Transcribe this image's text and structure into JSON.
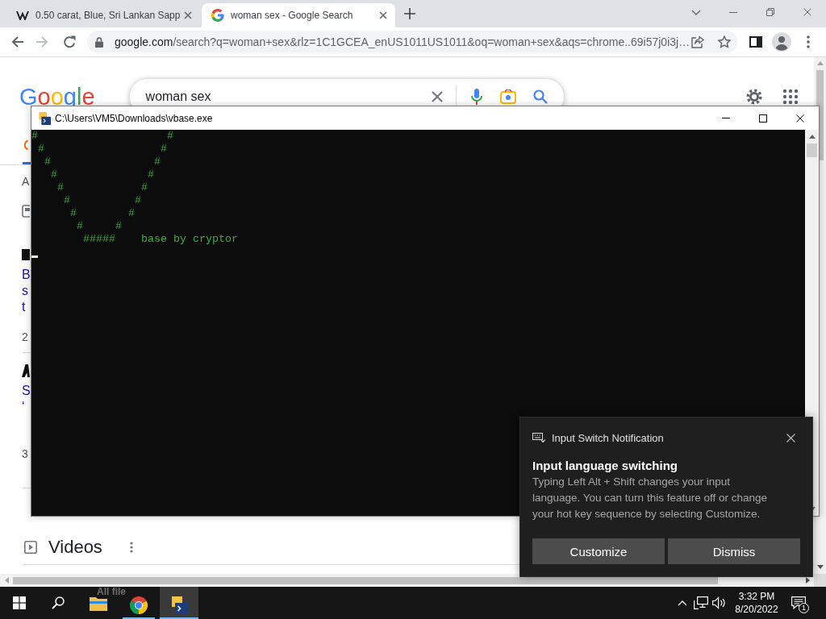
{
  "browser": {
    "tabs": [
      {
        "title": "0.50 carat, Blue, Sri Lankan Sapp",
        "selected": false
      },
      {
        "title": "woman sex - Google Search",
        "selected": true
      }
    ],
    "toolbar": {
      "forward_disabled": true
    },
    "address": {
      "host": "google.com",
      "path": "/search?q=woman+sex&rlz=1C1GCEA_enUS1011US1011&oq=woman+sex&aqs=chrome..69i57j0i3j…"
    }
  },
  "google": {
    "logo": "Google",
    "search": {
      "value": "woman sex"
    },
    "about": "A",
    "results": [
      {
        "title_lines": [
          "B",
          "s",
          "t"
        ],
        "snippet": "2"
      },
      {
        "title_lines": [
          "S",
          "‘"
        ],
        "snippet": "3"
      }
    ],
    "section": "Videos"
  },
  "console": {
    "title": "C:\\Users\\VM5\\Downloads\\vbase.exe",
    "lines": [
      "#                    #",
      " #                  #",
      "  #                #",
      "   #              #",
      "    #            #",
      "     #          #",
      "      #        #",
      "       #     #",
      "        #####    base by cryptor"
    ]
  },
  "notification": {
    "source": "Input Switch Notification",
    "title": "Input language switching",
    "body_lines": [
      "Typing Left Alt + Shift changes your input",
      "language. You can turn this feature off or change",
      "your hot key sequence by selecting Customize."
    ],
    "buttons": [
      "Customize",
      "Dismiss"
    ]
  },
  "taskbar": {
    "faded_label": "All file",
    "apps": [
      {
        "kind": "folder",
        "running": false,
        "selected": false
      },
      {
        "kind": "browser",
        "running": true,
        "selected": false
      },
      {
        "kind": "console",
        "running": true,
        "selected": true
      }
    ],
    "time": "3:32 PM",
    "date": "8/20/2022",
    "notification_count": "1"
  }
}
